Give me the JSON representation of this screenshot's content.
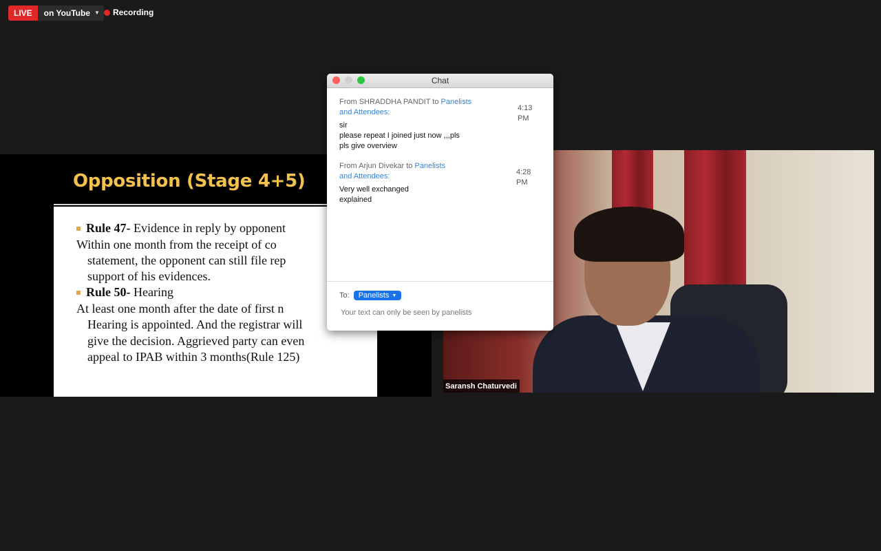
{
  "status_bar": {
    "live_label": "LIVE",
    "stream_target": "on YouTube",
    "recording_label": "Recording"
  },
  "slide": {
    "title": "Opposition (Stage 4+5)",
    "lines": [
      {
        "bold": "Rule 47-",
        "rest": " Evidence in reply by opponent"
      },
      {
        "text": "Within one month from the receipt of co"
      },
      {
        "text": "statement, the opponent can still file rep"
      },
      {
        "text": "support of his evidences."
      },
      {
        "bold": "Rule 50-",
        "rest": " Hearing"
      },
      {
        "text": "At least one month after the date of first n"
      },
      {
        "text": "Hearing is appointed. And the registrar will"
      },
      {
        "text": "give the decision. Aggrieved party can even"
      },
      {
        "text": "appeal to IPAB within 3 months(Rule 125)"
      }
    ]
  },
  "video": {
    "participant_name": "Saransh Chaturvedi"
  },
  "chat": {
    "title": "Chat",
    "messages": [
      {
        "from_prefix": "From SHRADDHA PANDIT to ",
        "to_line1": "Panelists",
        "to_line2": "and Attendees:",
        "time": "4:13 PM",
        "lines": [
          "sir",
          "please repeat I joined just now ,,,pls",
          "pls give overview"
        ]
      },
      {
        "from_prefix": "From Arjun Divekar to ",
        "to_line1": "Panelists",
        "to_line2": "and Attendees:",
        "time": "4:28 PM",
        "lines": [
          "Very well exchanged",
          "explained"
        ]
      }
    ],
    "to_label": "To:",
    "recipient": "Panelists",
    "hint": "Your text can only be seen by panelists"
  }
}
